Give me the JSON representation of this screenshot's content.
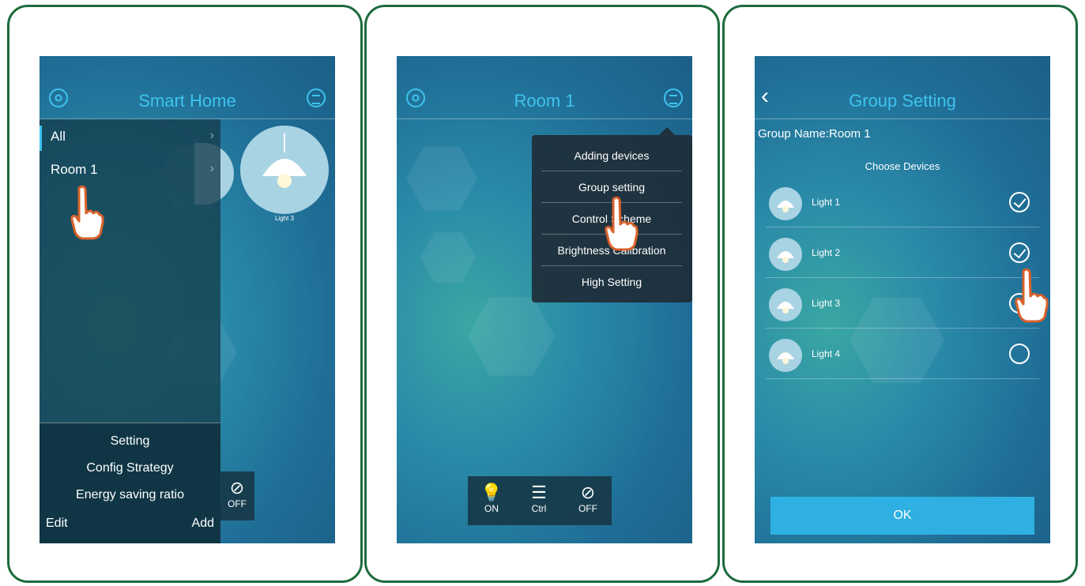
{
  "panel1": {
    "title": "Smart Home",
    "drawer_items": [
      "All",
      "Room 1"
    ],
    "drawer_bottom": [
      "Setting",
      "Config Strategy",
      "Energy saving ratio"
    ],
    "edit_label": "Edit",
    "add_label": "Add",
    "device_label": "Light 3",
    "off_label": "OFF"
  },
  "panel2": {
    "title": "Room 1",
    "menu_items": [
      "Adding devices",
      "Group setting",
      "Control Scheme",
      "Brightness Calibration",
      "High Setting"
    ],
    "controls": [
      "ON",
      "Ctrl",
      "OFF"
    ]
  },
  "panel3": {
    "title": "Group Setting",
    "group_name": "Group Name:Room 1",
    "choose_label": "Choose Devices",
    "devices": [
      {
        "name": "Light 1",
        "checked": true
      },
      {
        "name": "Light 2",
        "checked": true
      },
      {
        "name": "Light 3",
        "checked": false
      },
      {
        "name": "Light 4",
        "checked": false
      }
    ],
    "ok_label": "OK"
  },
  "colors": {
    "border": "#1c6b3c",
    "accent": "#3ec3ee",
    "button": "#2fb0e2",
    "hand_stroke": "#d9622b"
  }
}
